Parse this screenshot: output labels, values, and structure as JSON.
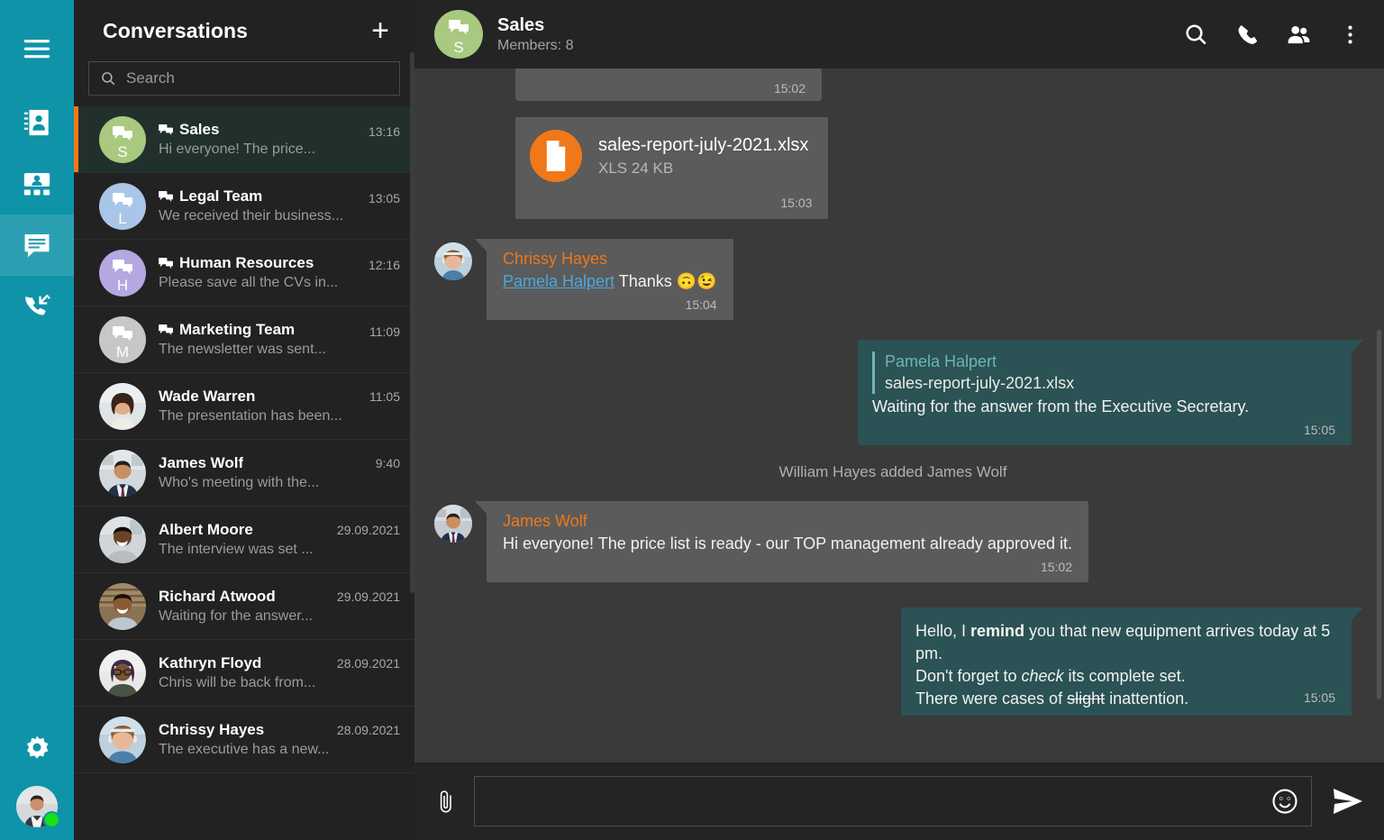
{
  "rail": {
    "menu_label": "Menu",
    "items": [
      {
        "id": "contacts",
        "icon": "address-book-icon",
        "label": "Contacts",
        "active": false
      },
      {
        "id": "teams",
        "icon": "org-group-icon",
        "label": "Teams",
        "active": false
      },
      {
        "id": "chats",
        "icon": "chat-bubble-icon",
        "label": "Chats",
        "active": true
      },
      {
        "id": "calls",
        "icon": "call-history-icon",
        "label": "Calls",
        "active": false
      }
    ],
    "settings_label": "Settings",
    "user_status": "online"
  },
  "conversations_panel": {
    "title": "Conversations",
    "add_label": "+",
    "search": {
      "placeholder": "Search",
      "value": ""
    },
    "items": [
      {
        "name": "Sales",
        "time": "13:16",
        "preview": "Hi everyone! The price...",
        "is_group": true,
        "letter": "S",
        "avatar_color": "#a8c97f",
        "selected": true
      },
      {
        "name": "Legal Team",
        "time": "13:05",
        "preview": "We received their business...",
        "is_group": true,
        "letter": "L",
        "avatar_color": "#a9c6e8",
        "selected": false
      },
      {
        "name": "Human Resources",
        "time": "12:16",
        "preview": "Please save all the CVs in...",
        "is_group": true,
        "letter": "H",
        "avatar_color": "#b5a7e0",
        "selected": false
      },
      {
        "name": "Marketing Team",
        "time": "11:09",
        "preview": "The newsletter was sent...",
        "is_group": true,
        "letter": "M",
        "avatar_color": "#c7c7c7",
        "selected": false
      },
      {
        "name": "Wade Warren",
        "time": "11:05",
        "preview": "The presentation has been...",
        "is_group": false,
        "letter": "",
        "avatar_color": "#d8cfc4",
        "selected": false
      },
      {
        "name": "James Wolf",
        "time": "9:40",
        "preview": "Who's meeting with the...",
        "is_group": false,
        "letter": "",
        "avatar_color": "#cbb9a4",
        "selected": false
      },
      {
        "name": "Albert Moore",
        "time": "29.09.2021",
        "preview": "The interview was set ...",
        "is_group": false,
        "letter": "",
        "avatar_color": "#b9a895",
        "selected": false
      },
      {
        "name": "Richard Atwood",
        "time": "29.09.2021",
        "preview": "Waiting for the answer...",
        "is_group": false,
        "letter": "",
        "avatar_color": "#a99177",
        "selected": false
      },
      {
        "name": "Kathryn Floyd",
        "time": "28.09.2021",
        "preview": "Chris will be back from...",
        "is_group": false,
        "letter": "",
        "avatar_color": "#ddd4cb",
        "selected": false
      },
      {
        "name": "Chrissy Hayes",
        "time": "28.09.2021",
        "preview": "The executive has a new...",
        "is_group": false,
        "letter": "",
        "avatar_color": "#d9c3b0",
        "selected": false
      }
    ]
  },
  "chat_header": {
    "title": "Sales",
    "subtitle": "Members: 8",
    "avatar_letter": "S",
    "avatar_color": "#a8c97f",
    "actions": [
      {
        "id": "search",
        "icon": "search-icon"
      },
      {
        "id": "call",
        "icon": "phone-icon"
      },
      {
        "id": "members",
        "icon": "people-icon"
      },
      {
        "id": "more",
        "icon": "more-vertical-icon"
      }
    ]
  },
  "messages": {
    "partial_top": {
      "time": "15:02"
    },
    "file_message": {
      "file_name": "sales-report-july-2021.xlsx",
      "file_meta": "XLS 24 KB",
      "time": "15:03",
      "icon": "document-icon",
      "icon_color": "#f07818"
    },
    "chrissy": {
      "sender": "Chrissy Hayes",
      "mention": "Pamela Halpert",
      "text": " Thanks ",
      "emoji": "🙃😉",
      "time": "15:04"
    },
    "reply_out": {
      "quote_name": "Pamela Halpert",
      "quote_text": "sales-report-july-2021.xlsx",
      "text": "Waiting for the answer from the Executive Secretary.",
      "time": "15:05"
    },
    "system": "William Hayes added James Wolf",
    "james": {
      "sender": "James Wolf",
      "text": "Hi everyone! The price list is ready - our TOP management already approved it.",
      "time": "15:02"
    },
    "reminder_out": {
      "line1_a": "Hello, I ",
      "line1_bold": "remind",
      "line1_b": " you that new equipment arrives today at 5 pm.",
      "line2_a": "Don't forget to ",
      "line2_italic": "check",
      "line2_b": " its complete set.",
      "line3_a": "There were cases of ",
      "line3_strike": "slight",
      "line3_b": " inattention.",
      "time": "15:05"
    }
  },
  "composer": {
    "attach_icon": "paperclip-icon",
    "placeholder": "",
    "value": "",
    "emoji_icon": "smiley-icon",
    "send_icon": "send-icon"
  },
  "colors": {
    "rail": "#0f93a8",
    "rail_active": "#2aa0b2",
    "accent_orange": "#f07818",
    "selected_row": "#21302c",
    "out_bubble": "#2b5254",
    "in_bubble": "#5b5b5b",
    "mention_blue": "#4aa8dd",
    "status_green": "#17e017"
  }
}
